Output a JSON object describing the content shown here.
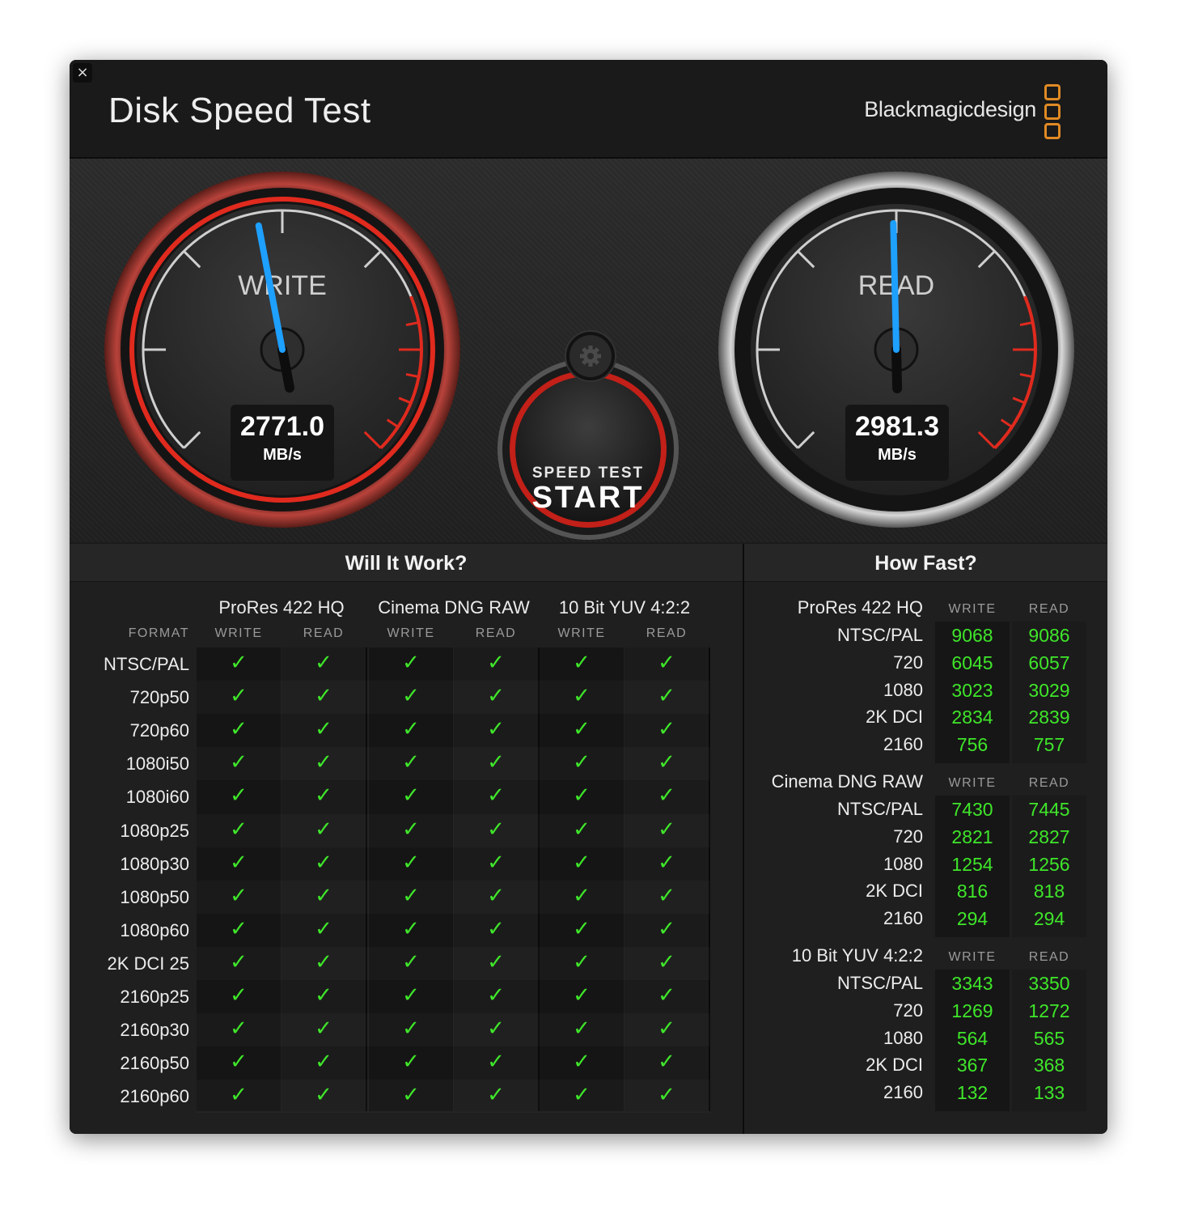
{
  "window": {
    "title": "Disk Speed Test",
    "brand": "Blackmagicdesign",
    "close_label": "×"
  },
  "gauges": {
    "write": {
      "label": "WRITE",
      "value": "2771.0",
      "unit": "MB/s",
      "needle_fraction": 0.46
    },
    "read": {
      "label": "READ",
      "value": "2981.3",
      "unit": "MB/s",
      "needle_fraction": 0.495
    },
    "accent_write": "#e02a1e",
    "needle_color": "#1ea0ff"
  },
  "start_button": {
    "sub": "SPEED TEST",
    "main": "START"
  },
  "settings_icon": "gear-icon",
  "will_it_work": {
    "title": "Will It Work?",
    "format_label": "FORMAT",
    "groups": [
      "ProRes 422 HQ",
      "Cinema DNG RAW",
      "10 Bit YUV 4:2:2"
    ],
    "sub_labels": [
      "WRITE",
      "READ",
      "WRITE",
      "READ",
      "WRITE",
      "READ"
    ],
    "check_glyph": "✓",
    "rows": [
      "NTSC/PAL",
      "720p50",
      "720p60",
      "1080i50",
      "1080i60",
      "1080p25",
      "1080p30",
      "1080p50",
      "1080p60",
      "2K DCI 25",
      "2160p25",
      "2160p30",
      "2160p50",
      "2160p60"
    ],
    "check_color": "#3fe62a"
  },
  "how_fast": {
    "title": "How Fast?",
    "write_label": "WRITE",
    "read_label": "READ",
    "sections": [
      {
        "name": "ProRes 422 HQ",
        "rows": [
          {
            "label": "NTSC/PAL",
            "write": "9068",
            "read": "9086"
          },
          {
            "label": "720",
            "write": "6045",
            "read": "6057"
          },
          {
            "label": "1080",
            "write": "3023",
            "read": "3029"
          },
          {
            "label": "2K DCI",
            "write": "2834",
            "read": "2839"
          },
          {
            "label": "2160",
            "write": "756",
            "read": "757"
          }
        ]
      },
      {
        "name": "Cinema DNG RAW",
        "rows": [
          {
            "label": "NTSC/PAL",
            "write": "7430",
            "read": "7445"
          },
          {
            "label": "720",
            "write": "2821",
            "read": "2827"
          },
          {
            "label": "1080",
            "write": "1254",
            "read": "1256"
          },
          {
            "label": "2K DCI",
            "write": "816",
            "read": "818"
          },
          {
            "label": "2160",
            "write": "294",
            "read": "294"
          }
        ]
      },
      {
        "name": "10 Bit YUV 4:2:2",
        "rows": [
          {
            "label": "NTSC/PAL",
            "write": "3343",
            "read": "3350"
          },
          {
            "label": "720",
            "write": "1269",
            "read": "1272"
          },
          {
            "label": "1080",
            "write": "564",
            "read": "565"
          },
          {
            "label": "2K DCI",
            "write": "367",
            "read": "368"
          },
          {
            "label": "2160",
            "write": "132",
            "read": "133"
          }
        ]
      }
    ]
  }
}
